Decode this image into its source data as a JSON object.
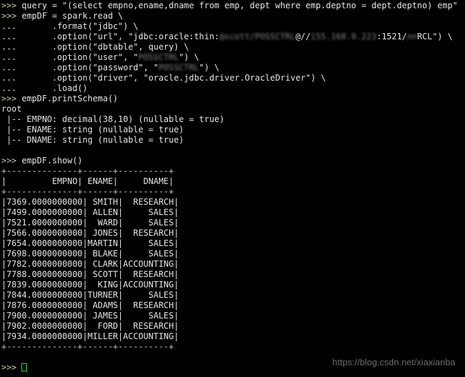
{
  "terminal": {
    "background_color": "#000000",
    "text_color": "#d8d8d8",
    "prompt_color": "#ccc9a0",
    "cursor_color": "#22e022",
    "prompt": ">>>",
    "continuation_prompt": "...",
    "lines": [
      {
        "type": "prompt",
        "prompt": ">>> ",
        "text": "query = \"(select empno,ename,dname from emp, dept where emp.deptno = dept.deptno) emp\""
      },
      {
        "type": "prompt",
        "prompt": ">>> ",
        "text": "empDF = spark.read \\"
      },
      {
        "type": "cont",
        "prompt": "...   ",
        "text": "    .format(\"jdbc\") \\"
      },
      {
        "type": "cont_redacted",
        "prompt": "...   ",
        "pre": "    .option(\"url\", \"jdbc:oracle:thin:",
        "redacted": "@scott/POSSCTRL",
        "mid": "@//",
        "redacted2": "155.168.9.223",
        "post": ":1521/",
        "redacted3": "nn",
        "tail": "RCL\") \\"
      },
      {
        "type": "cont",
        "prompt": "...   ",
        "text": "    .option(\"dbtable\", query) \\"
      },
      {
        "type": "cont_secret",
        "prompt": "...   ",
        "pre": "    .option(\"user\", \"",
        "secret": "POSSCTRL",
        "post": "\") \\"
      },
      {
        "type": "cont_secret",
        "prompt": "...   ",
        "pre": "    .option(\"password\", \"",
        "secret": "POSSCTRL",
        "post": "\") \\"
      },
      {
        "type": "cont",
        "prompt": "...   ",
        "text": "    .option(\"driver\", \"oracle.jdbc.driver.OracleDriver\") \\"
      },
      {
        "type": "cont",
        "prompt": "...   ",
        "text": "    .load()"
      },
      {
        "type": "prompt",
        "prompt": ">>> ",
        "text": "empDF.printSchema()"
      },
      {
        "type": "out",
        "text": "root"
      },
      {
        "type": "out",
        "text": " |-- EMPNO: decimal(38,10) (nullable = true)"
      },
      {
        "type": "out",
        "text": " |-- ENAME: string (nullable = true)"
      },
      {
        "type": "out",
        "text": " |-- DNAME: string (nullable = true)"
      },
      {
        "type": "blank",
        "text": ""
      },
      {
        "type": "prompt",
        "prompt": ">>> ",
        "text": "empDF.show()"
      },
      {
        "type": "sep",
        "text": "+--------------+------+----------+"
      },
      {
        "type": "out",
        "text": "|         EMPNO| ENAME|     DNAME|"
      },
      {
        "type": "sep",
        "text": "+--------------+------+----------+"
      },
      {
        "type": "out",
        "text": "|7369.0000000000| SMITH|  RESEARCH|"
      },
      {
        "type": "out",
        "text": "|7499.0000000000| ALLEN|     SALES|"
      },
      {
        "type": "out",
        "text": "|7521.0000000000|  WARD|     SALES|"
      },
      {
        "type": "out",
        "text": "|7566.0000000000| JONES|  RESEARCH|"
      },
      {
        "type": "out",
        "text": "|7654.0000000000|MARTIN|     SALES|"
      },
      {
        "type": "out",
        "text": "|7698.0000000000| BLAKE|     SALES|"
      },
      {
        "type": "out",
        "text": "|7782.0000000000| CLARK|ACCOUNTING|"
      },
      {
        "type": "out",
        "text": "|7788.0000000000| SCOTT|  RESEARCH|"
      },
      {
        "type": "out",
        "text": "|7839.0000000000|  KING|ACCOUNTING|"
      },
      {
        "type": "out",
        "text": "|7844.0000000000|TURNER|     SALES|"
      },
      {
        "type": "out",
        "text": "|7876.0000000000| ADAMS|  RESEARCH|"
      },
      {
        "type": "out",
        "text": "|7900.0000000000| JAMES|     SALES|"
      },
      {
        "type": "out",
        "text": "|7902.0000000000|  FORD|  RESEARCH|"
      },
      {
        "type": "out",
        "text": "|7934.0000000000|MILLER|ACCOUNTING|"
      },
      {
        "type": "sep",
        "text": "+--------------+------+----------+"
      },
      {
        "type": "blank",
        "text": ""
      },
      {
        "type": "cursor",
        "prompt": ">>> ",
        "text": ""
      }
    ]
  },
  "schema": {
    "root_label": "root",
    "fields": [
      {
        "name": "EMPNO",
        "datatype": "decimal(38,10)",
        "nullable": "true"
      },
      {
        "name": "ENAME",
        "datatype": "string",
        "nullable": "true"
      },
      {
        "name": "DNAME",
        "datatype": "string",
        "nullable": "true"
      }
    ]
  },
  "table": {
    "columns": [
      "EMPNO",
      "ENAME",
      "DNAME"
    ],
    "rows": [
      [
        "7369.0000000000",
        "SMITH",
        "RESEARCH"
      ],
      [
        "7499.0000000000",
        "ALLEN",
        "SALES"
      ],
      [
        "7521.0000000000",
        "WARD",
        "SALES"
      ],
      [
        "7566.0000000000",
        "JONES",
        "RESEARCH"
      ],
      [
        "7654.0000000000",
        "MARTIN",
        "SALES"
      ],
      [
        "7698.0000000000",
        "BLAKE",
        "SALES"
      ],
      [
        "7782.0000000000",
        "CLARK",
        "ACCOUNTING"
      ],
      [
        "7788.0000000000",
        "SCOTT",
        "RESEARCH"
      ],
      [
        "7839.0000000000",
        "KING",
        "ACCOUNTING"
      ],
      [
        "7844.0000000000",
        "TURNER",
        "SALES"
      ],
      [
        "7876.0000000000",
        "ADAMS",
        "RESEARCH"
      ],
      [
        "7900.0000000000",
        "JAMES",
        "SALES"
      ],
      [
        "7902.0000000000",
        "FORD",
        "RESEARCH"
      ],
      [
        "7934.0000000000",
        "MILLER",
        "ACCOUNTING"
      ]
    ]
  },
  "watermark": {
    "text": "https://blog.csdn.net/xiaxianba",
    "color": "#6f6f6f"
  }
}
